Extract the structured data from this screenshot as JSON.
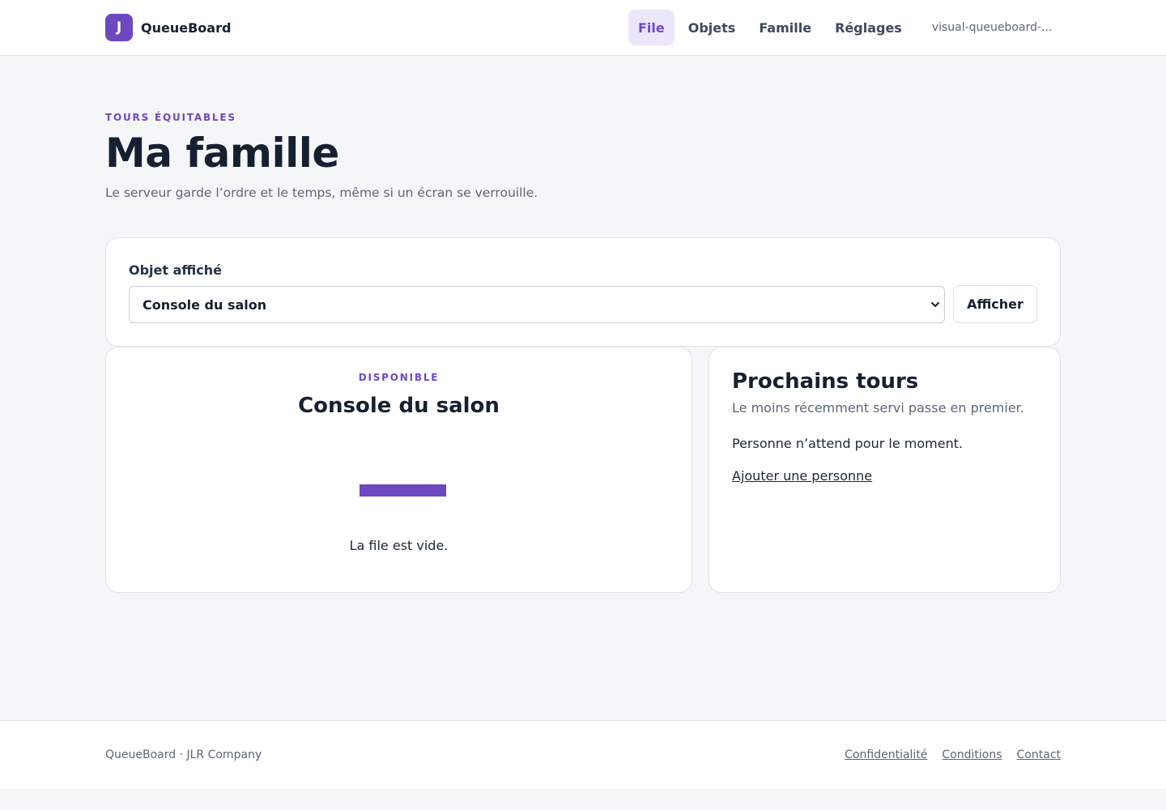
{
  "header": {
    "logo_letter": "J",
    "brand": "QueueBoard",
    "nav": [
      {
        "label": "File",
        "active": true
      },
      {
        "label": "Objets"
      },
      {
        "label": "Famille"
      },
      {
        "label": "Réglages"
      }
    ],
    "user": "visual-queueboard-..."
  },
  "hero": {
    "eyebrow": "TOURS ÉQUITABLES",
    "title": "Ma famille",
    "subtitle": "Le serveur garde l’ordre et le temps, même si un écran se verrouille."
  },
  "picker": {
    "label": "Objet affiché",
    "selected": "Console du salon",
    "button": "Afficher"
  },
  "now": {
    "status": "DISPONIBLE",
    "title": "Console du salon",
    "empty": "La file est vide."
  },
  "next": {
    "title": "Prochains tours",
    "subtitle": "Le moins récemment servi passe en premier.",
    "empty": "Personne n’attend pour le moment.",
    "add_link": "Ajouter une personne"
  },
  "footer": {
    "brand": "QueueBoard · JLR Company",
    "links": [
      "Confidentialité",
      "Conditions",
      "Contact"
    ]
  },
  "colors": {
    "accent": "#6e48c0",
    "accent_soft": "#ece6fb",
    "background": "#f5f6f8"
  }
}
